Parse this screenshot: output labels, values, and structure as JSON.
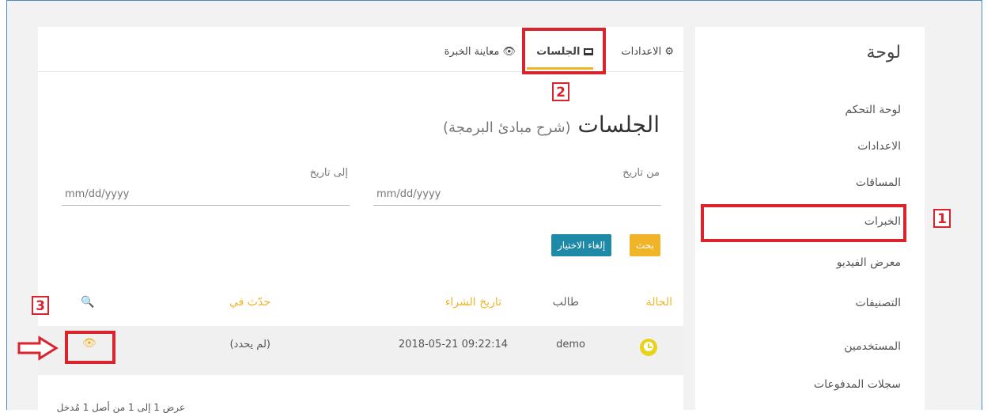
{
  "sidebar": {
    "title": "لوحة",
    "items": [
      "لوحة التحكم",
      "الاعدادات",
      "المساقات",
      "الخبرات",
      "معرض الفيديو",
      "التصنيفات",
      "المستخدمين",
      "سجلات المدفوعات"
    ]
  },
  "tabs": {
    "settings": "الاعدادات",
    "sessions": "الجلسات",
    "preview": "معاينة الخبرة"
  },
  "page": {
    "title": "الجلسات",
    "subtitle": "(شرح مبادئ البرمجة)"
  },
  "filters": {
    "from_label": "من تاريخ",
    "to_label": "إلى تاريخ",
    "from_placeholder": "mm/dd/yyyy",
    "to_placeholder": "mm/dd/yyyy",
    "search_button": "بحث",
    "reset_button": "إلغاء الاختيار"
  },
  "table": {
    "headers": {
      "status": "الحالة",
      "student": "طالب",
      "purchase_date": "تاريخ الشراء",
      "happened_in": "حدّث في"
    },
    "rows": [
      {
        "student": "demo",
        "purchase_date": "09:22:14 2018-05-21",
        "happened_in": "(لم يحدد)"
      }
    ]
  },
  "footer": {
    "text": "عرض 1 إلى 1 من أصل 1 مُدخل"
  },
  "annotations": {
    "n1": "1",
    "n2": "2",
    "n3": "3"
  },
  "colors": {
    "accent": "#f0b429",
    "teal": "#1f8aa8",
    "annotation": "#d9232d",
    "status_icon": "#e8d21a"
  }
}
